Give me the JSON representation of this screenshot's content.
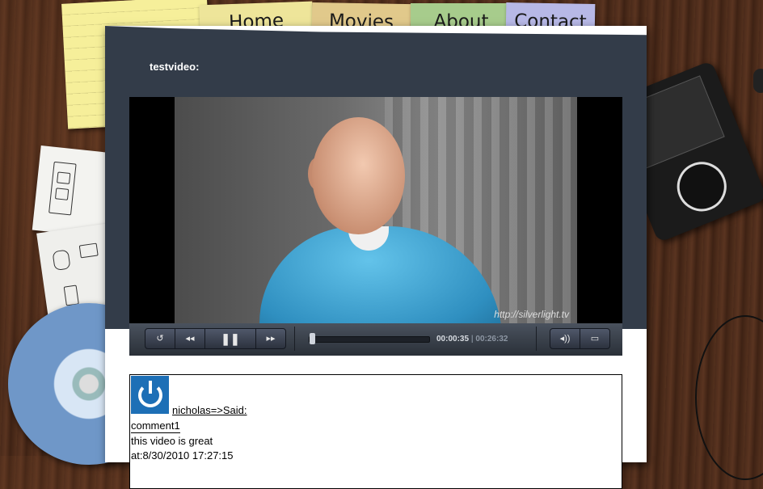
{
  "nav": {
    "home": "Home",
    "movies": "Movies",
    "about": "About",
    "contact": "Contact"
  },
  "video": {
    "title": "testvideo:",
    "watermark": "http://silverlight.tv",
    "current_time": "00:00:35",
    "separator": "|",
    "duration": "00:26:32",
    "progress": 0.022
  },
  "controls": {
    "replay": "↺",
    "rewind": "◂◂",
    "pause": "❚❚",
    "forward": "▸▸",
    "volume": "◂))",
    "fullscreen": "▭"
  },
  "comment": {
    "author": "nicholas=>Said:",
    "title": "comment1",
    "body": "this video is great",
    "date": "at:8/30/2010 17:27:15"
  },
  "colors": {
    "panel_header": "#333c49",
    "avatar": "#1d6fb6"
  }
}
